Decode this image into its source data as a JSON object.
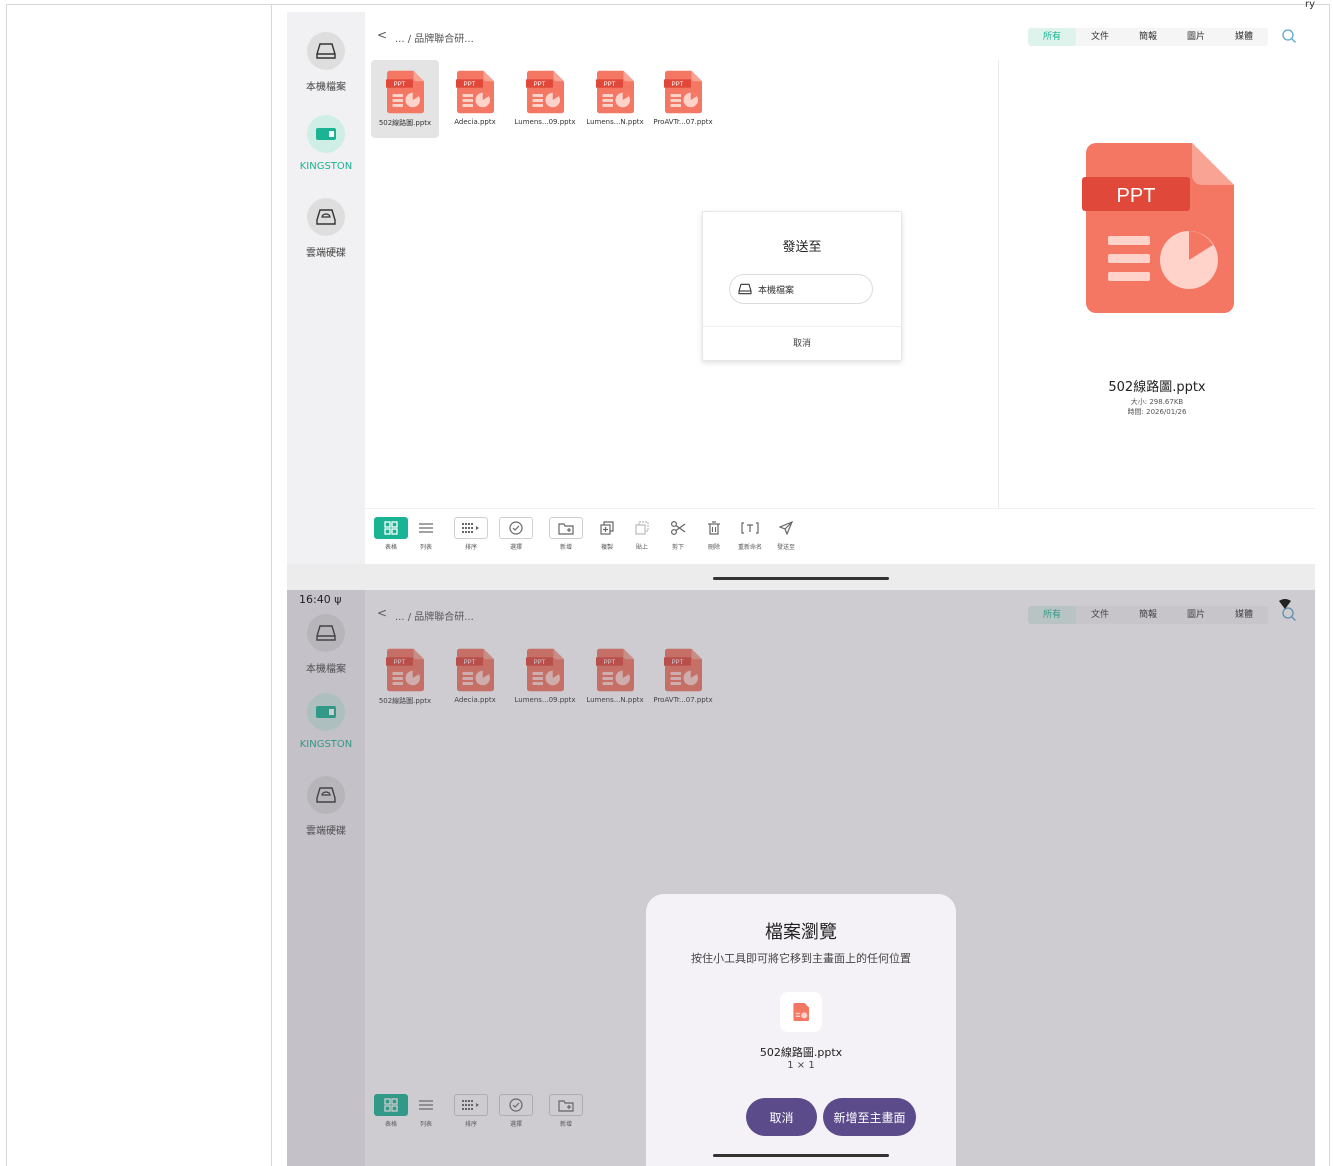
{
  "corner_text": "ry",
  "sidebar": {
    "items": [
      {
        "label": "本機檔案",
        "icon": "drive-icon"
      },
      {
        "label": "KINGSTON",
        "icon": "usb-drive-icon"
      },
      {
        "label": "雲端硬碟",
        "icon": "cloud-drive-icon"
      }
    ]
  },
  "header": {
    "back_label": "<",
    "breadcrumb": "... / 品牌聯合研...",
    "tabs": [
      "所有",
      "文件",
      "簡報",
      "圖片",
      "媒體"
    ],
    "active_tab": "所有"
  },
  "files": [
    {
      "name": "502線路圖.pptx",
      "badge": "PPT"
    },
    {
      "name": "Adecia.pptx",
      "badge": "PPT"
    },
    {
      "name": "Lumens...09.pptx",
      "badge": "PPT"
    },
    {
      "name": "Lumens...N.pptx",
      "badge": "PPT"
    },
    {
      "name": "ProAVTr...07.pptx",
      "badge": "PPT"
    }
  ],
  "preview": {
    "badge": "PPT",
    "name": "502線路圖.pptx",
    "size": "大小: 298.67KB",
    "time": "時間: 2026/01/26"
  },
  "toolbar": {
    "items": [
      "表格",
      "列表",
      "排序",
      "選擇",
      "新增",
      "複製",
      "貼上",
      "剪下",
      "刪除",
      "重新命名",
      "發送至"
    ]
  },
  "send_dialog": {
    "title": "發送至",
    "option": "本機檔案",
    "cancel": "取消"
  },
  "status": {
    "time": "16:40 ψ"
  },
  "widget_sheet": {
    "title": "檔案瀏覽",
    "subtitle": "按住小工具即可將它移到主畫面上的任何位置",
    "file_name": "502線路圖.pptx",
    "size": "1 × 1",
    "cancel": "取消",
    "add": "新增至主畫面"
  },
  "colors": {
    "accent": "#1ab394",
    "ppt": "#f26f5c",
    "sheet_button": "#5b4b8a"
  }
}
